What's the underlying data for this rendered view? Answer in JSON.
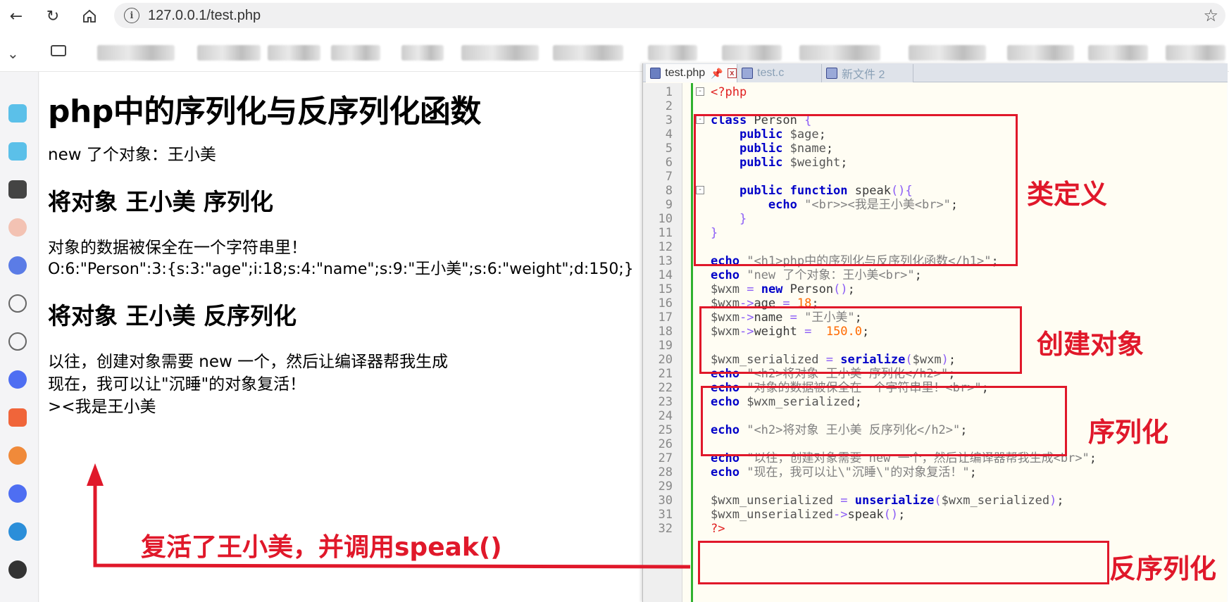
{
  "browser": {
    "url": "127.0.0.1/test.php"
  },
  "page": {
    "h1": "php中的序列化与反序列化函数",
    "line_new": "new 了个对象：王小美",
    "h2_serialize": "将对象 王小美 序列化",
    "line_saved": "对象的数据被保全在一个字符串里！",
    "serialized": "O:6:\"Person\":3:{s:3:\"age\";i:18;s:4:\"name\";s:9:\"王小美\";s:6:\"weight\";d:150;}",
    "h2_unserialize": "将对象 王小美 反序列化",
    "line_past": "以往，创建对象需要 new 一个，然后让编译器帮我生成",
    "line_now": "现在，我可以让\"沉睡\"的对象复活！",
    "line_speak": "><我是王小美"
  },
  "editor": {
    "tabs": [
      {
        "label": "test.php"
      },
      {
        "label": "test.c"
      },
      {
        "label": "新文件 2"
      }
    ],
    "lines": [
      "1",
      "2",
      "3",
      "4",
      "5",
      "6",
      "7",
      "8",
      "9",
      "10",
      "11",
      "12",
      "13",
      "14",
      "15",
      "16",
      "17",
      "18",
      "19",
      "20",
      "21",
      "22",
      "23",
      "24",
      "25",
      "26",
      "27",
      "28",
      "29",
      "30",
      "31",
      "32"
    ]
  },
  "annotations": {
    "class_def": "类定义",
    "create_obj": "创建对象",
    "serialize": "序列化",
    "unserialize": "反序列化",
    "revive": "复活了王小美，并调用speak()"
  },
  "colors": {
    "annotation_red": "#e0182a",
    "keyword_blue": "#0000c8",
    "fold_green": "#2fb12f"
  }
}
